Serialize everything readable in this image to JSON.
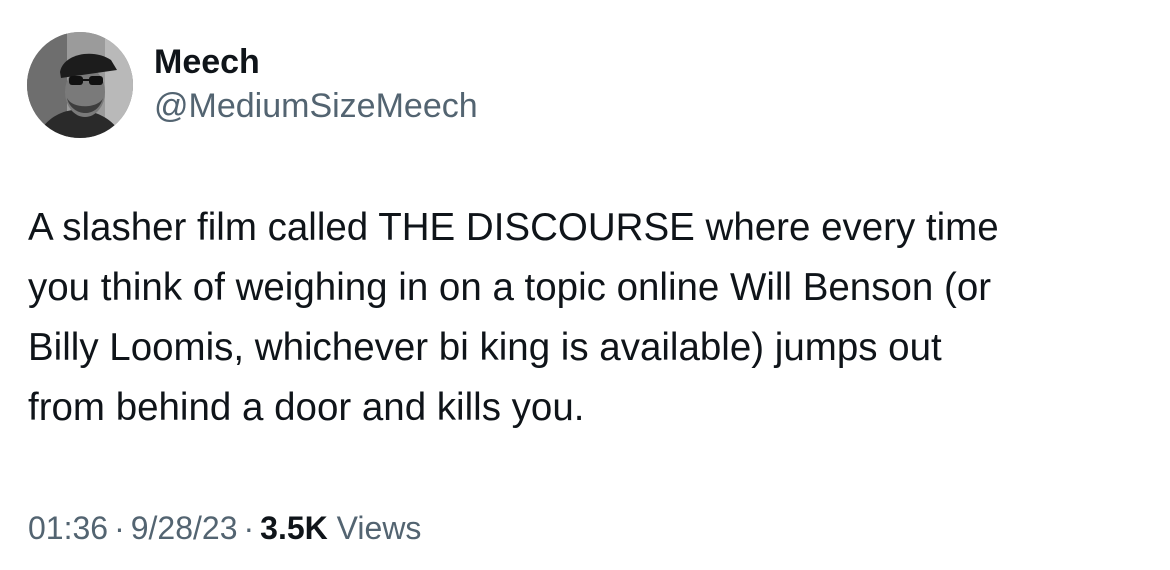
{
  "author": {
    "display_name": "Meech",
    "handle": "@MediumSizeMeech",
    "avatar": "profile-photo"
  },
  "tweet": {
    "text_lines": [
      "A slasher film called THE DISCOURSE where every time",
      "you think of weighing in on a topic online Will Benson (or",
      "Billy Loomis, whichever bi king is available) jumps out",
      "from behind a door and kills you."
    ]
  },
  "meta": {
    "time": "01:36",
    "separator": "·",
    "date": "9/28/23",
    "views_count": "3.5K",
    "views_label": "Views"
  },
  "colors": {
    "text": "#0f1419",
    "secondary": "#536471",
    "background": "#ffffff"
  }
}
